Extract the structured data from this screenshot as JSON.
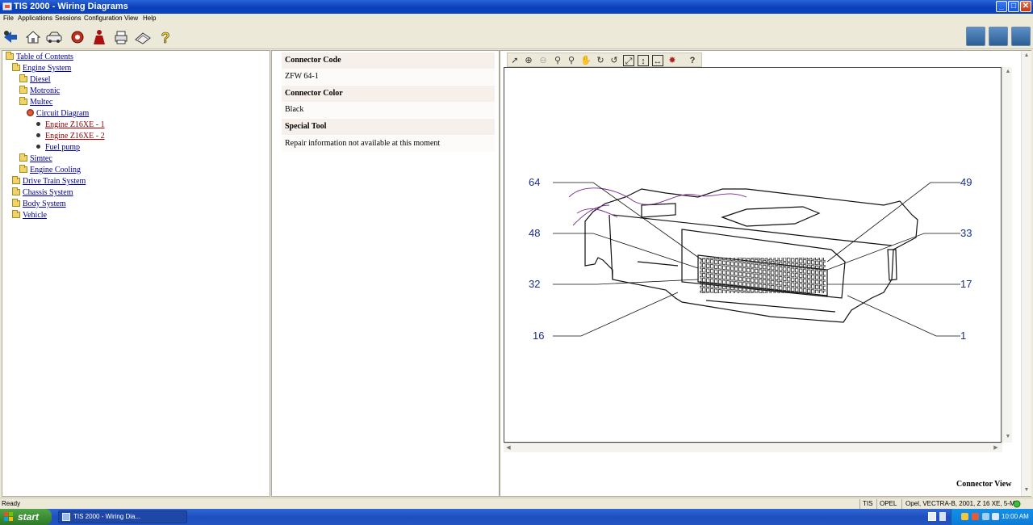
{
  "window": {
    "title": "TIS 2000 - Wiring Diagrams",
    "min": "_",
    "max": "□",
    "close": "✕"
  },
  "menu": [
    "File",
    "Applications",
    "Sessions",
    "Configuration",
    "View",
    "Help"
  ],
  "toolbar_icons": [
    "exit-icon",
    "home-icon",
    "vehicle-icon",
    "diagnostics-icon",
    "person-icon",
    "print-icon",
    "book-icon",
    "help-icon"
  ],
  "toolbar_right_icons": [
    "module-a-icon",
    "module-b-icon",
    "module-c-icon"
  ],
  "tree": [
    {
      "label": "Table of Contents",
      "type": "folder",
      "level": 0
    },
    {
      "label": "Engine System",
      "type": "folder",
      "level": 1
    },
    {
      "label": "Diesel",
      "type": "folder",
      "level": 2
    },
    {
      "label": "Motronic",
      "type": "folder",
      "level": 2
    },
    {
      "label": "Multec",
      "type": "folder",
      "level": 2
    },
    {
      "label": "Circuit Diagram",
      "type": "diagram",
      "level": 3
    },
    {
      "label": "Engine Z16XE - 1",
      "type": "bullet",
      "level": 4,
      "selected": true
    },
    {
      "label": "Engine Z16XE - 2",
      "type": "bullet",
      "level": 4,
      "selected": true
    },
    {
      "label": "Fuel pump",
      "type": "bullet",
      "level": 4
    },
    {
      "label": "Simtec",
      "type": "folder",
      "level": 2
    },
    {
      "label": "Engine Cooling",
      "type": "folder",
      "level": 2
    },
    {
      "label": "Drive Train System",
      "type": "folder",
      "level": 1
    },
    {
      "label": "Chassis System",
      "type": "folder",
      "level": 1
    },
    {
      "label": "Body System",
      "type": "folder",
      "level": 1
    },
    {
      "label": "Vehicle",
      "type": "folder",
      "level": 1
    }
  ],
  "info": {
    "connector_code_label": "Connector Code",
    "connector_code": "ZFW 64-1",
    "connector_color_label": "Connector Color",
    "connector_color": "Black",
    "special_tool_label": "Special Tool",
    "special_tool": "Repair information not available at this moment"
  },
  "viewer": {
    "tools": [
      "select-icon",
      "zoom-in-icon",
      "zoom-out-icon",
      "magnify-icon",
      "magnify-area-icon",
      "pan-icon",
      "rotate-cw-icon",
      "rotate-ccw-icon",
      "fit-page-icon",
      "fit-height-icon",
      "fit-width-icon",
      "highlight-icon",
      "help-icon"
    ],
    "pin_labels": {
      "p64": "64",
      "p48": "48",
      "p32": "32",
      "p16": "16",
      "p49": "49",
      "p33": "33",
      "p17": "17",
      "p1": "1"
    },
    "caption": "Connector View"
  },
  "status": {
    "ready": "Ready",
    "mode": "TIS",
    "brand": "OPEL",
    "vehicle": "Opel, VECTRA-B, 2001, Z 16 XE, 5-MT"
  },
  "taskbar": {
    "start": "start",
    "task": "TIS 2000 - Wiring Dia...",
    "clock": "10:00 AM"
  }
}
